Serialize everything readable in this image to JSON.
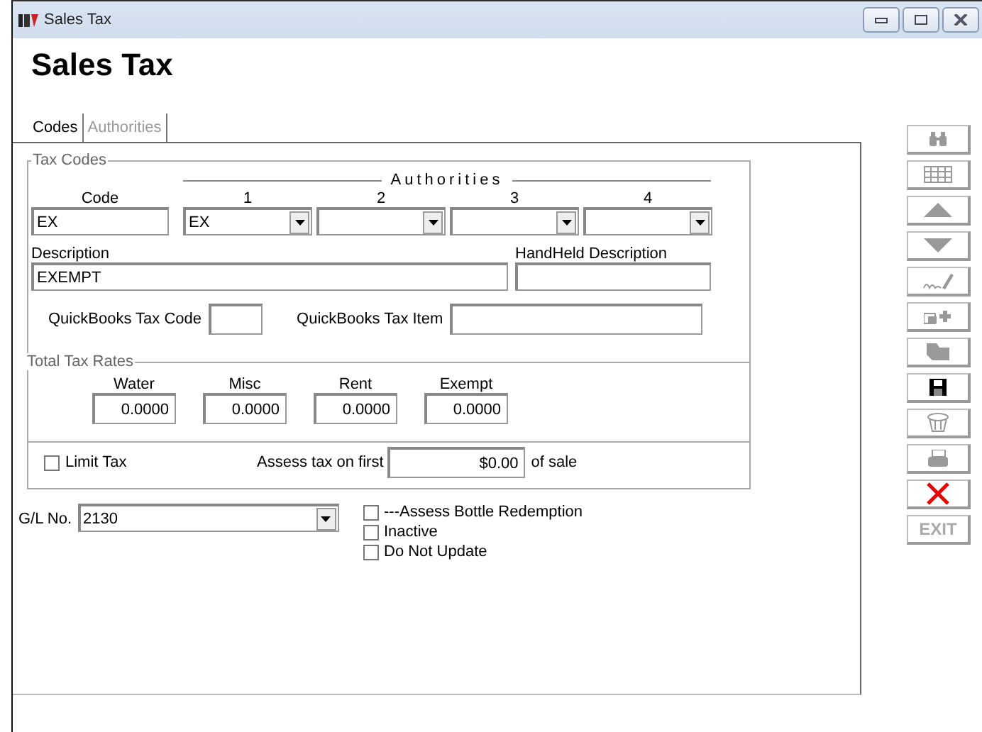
{
  "window": {
    "title": "Sales Tax"
  },
  "heading": "Sales Tax",
  "tabs": [
    {
      "label": "Codes",
      "selected": true
    },
    {
      "label": "Authorities",
      "selected": false
    }
  ],
  "tax_codes": {
    "legend": "Tax Codes",
    "authorities_label": "Authorities",
    "code_label": "Code",
    "code": "EX",
    "authorities": [
      {
        "label": "1",
        "value": "EX"
      },
      {
        "label": "2"
      },
      {
        "label": "3"
      },
      {
        "label": "4"
      }
    ],
    "description_label": "Description",
    "description": "EXEMPT",
    "handheld_label": "HandHeld Description",
    "quickbooks_code_label": "QuickBooks Tax Code",
    "quickbooks_item_label": "QuickBooks Tax Item",
    "rates": {
      "legend": "Total Tax Rates",
      "items": [
        {
          "label": "Water",
          "value": "0.0000"
        },
        {
          "label": "Misc",
          "value": "0.0000"
        },
        {
          "label": "Rent",
          "value": "0.0000"
        },
        {
          "label": "Exempt",
          "value": "0.0000"
        }
      ]
    },
    "limit_tax": {
      "label": "Limit Tax",
      "checked": false
    },
    "assess_label": "Assess tax on first",
    "assess_value": "$0.00",
    "assess_suffix": "of sale"
  },
  "gl": {
    "label": "G/L No.",
    "value": "2130"
  },
  "options": [
    {
      "label": "---Assess Bottle Redemption",
      "checked": false
    },
    {
      "label": "Inactive",
      "checked": false
    },
    {
      "label": "Do Not Update",
      "checked": false
    }
  ],
  "toolbar": [
    {
      "kind": "find",
      "disabled": true
    },
    {
      "kind": "grid",
      "disabled": true
    },
    {
      "kind": "up",
      "disabled": true
    },
    {
      "kind": "down",
      "disabled": true
    },
    {
      "kind": "sign",
      "disabled": true
    },
    {
      "kind": "add",
      "disabled": true
    },
    {
      "kind": "folder",
      "disabled": true
    },
    {
      "kind": "save",
      "disabled": false
    },
    {
      "kind": "delete",
      "disabled": true
    },
    {
      "kind": "print",
      "disabled": true
    },
    {
      "kind": "cancel",
      "disabled": false
    },
    {
      "kind": "exit",
      "label": "EXIT",
      "disabled": true
    }
  ]
}
